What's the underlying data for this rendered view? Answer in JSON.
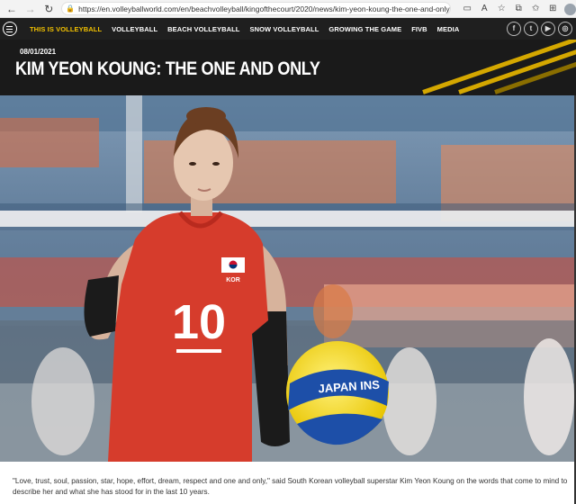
{
  "browser": {
    "back": "←",
    "forward": "→",
    "reload": "↻",
    "url": "https://en.volleyballworld.com/en/beachvolleyball/kingofthecourt/2020/news/kim-yeon-koung-the-one-and-only?..."
  },
  "nav": {
    "active": "THIS IS VOLLEYBALL",
    "items": [
      "VOLLEYBALL",
      "BEACH VOLLEYBALL",
      "SNOW VOLLEYBALL",
      "GROWING THE GAME",
      "FIVB",
      "MEDIA"
    ],
    "social": [
      "f",
      "t",
      "▶",
      "◎"
    ]
  },
  "article": {
    "date": "08/01/2021",
    "title": "KIM YEON KOUNG: THE ONE AND ONLY",
    "jersey_number": "10",
    "jersey_country": "KOR",
    "ball_text": "JAPAN INS",
    "caption": "\"Love, trust, soul, passion, star, hope, effort, dream, respect and one and only,\" said South Korean volleyball superstar Kim Yeon Koung on the words that come to mind to describe her and what she has stood for in the last 10 years."
  },
  "colors": {
    "accent": "#f2c100",
    "nav_bg": "#1f1f1f",
    "jersey": "#d63c2c"
  }
}
